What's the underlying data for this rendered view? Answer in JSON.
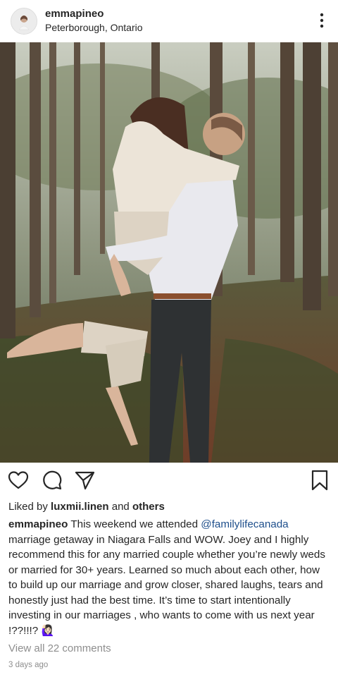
{
  "post": {
    "username": "emmapineo",
    "location": "Peterborough, Ontario",
    "photo": {
      "alt": "",
      "tint": "#6b6e5e"
    },
    "likes": {
      "prefix": "Liked by",
      "user": "luxmii.linen",
      "conj": "and",
      "others": "others"
    },
    "caption": {
      "user": "emmapineo",
      "text_1": "This weekend we attended",
      "mention": "@familylifecanada",
      "text_2": "marriage getaway in Niagara Falls and WOW. Joey and I highly recommend this for any married couple whether you’re newly weds or married for 30+ years. Learned so much about each other, how to build up our marriage and grow closer, shared laughs, tears and honestly just had the best time. It’s time to start intentionally investing in our marriages , who wants to come with us next year !??!!!? 🙋🏻‍♀️"
    },
    "comments_link": "View all 22 comments",
    "timestamp": "3 days ago"
  },
  "icons": {
    "avatar": "avatar-icon",
    "more": "more-options-icon",
    "like": "heart-icon",
    "comment": "comment-bubble-icon",
    "share": "send-paper-plane-icon",
    "save": "bookmark-icon"
  },
  "colors": {
    "mention": "#1e4f8c",
    "muted": "#8e8e8e",
    "text": "#262626"
  }
}
